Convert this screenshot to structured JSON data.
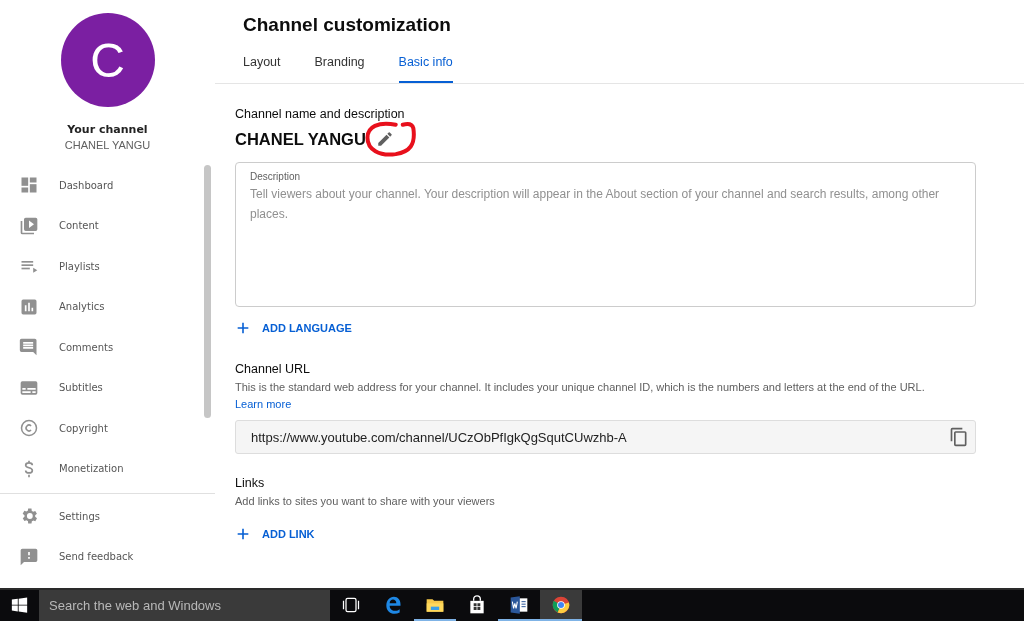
{
  "sidebar": {
    "avatar_letter": "C",
    "channel_label": "Your channel",
    "channel_name": "CHANEL YANGU",
    "items": [
      {
        "label": "Dashboard",
        "selected": false
      },
      {
        "label": "Content",
        "selected": false
      },
      {
        "label": "Playlists",
        "selected": false
      },
      {
        "label": "Analytics",
        "selected": false
      },
      {
        "label": "Comments",
        "selected": false
      },
      {
        "label": "Subtitles",
        "selected": false
      },
      {
        "label": "Copyright",
        "selected": false
      },
      {
        "label": "Monetization",
        "selected": false
      }
    ],
    "footer_items": [
      {
        "label": "Settings"
      },
      {
        "label": "Send feedback"
      }
    ]
  },
  "header": {
    "title": "Channel customization",
    "tabs": [
      {
        "label": "Layout",
        "selected": false
      },
      {
        "label": "Branding",
        "selected": false
      },
      {
        "label": "Basic info",
        "selected": true
      }
    ]
  },
  "name_section": {
    "heading": "Channel name and description",
    "channel_name": "CHANEL YANGU",
    "description": {
      "label": "Description",
      "placeholder": "Tell viewers about your channel. Your description will appear in the About section of your channel and search results, among other places."
    },
    "add_language": "ADD LANGUAGE"
  },
  "url_section": {
    "heading": "Channel URL",
    "text": "This is the standard web address for your channel. It includes your unique channel ID, which is the numbers and letters at the end of the URL.",
    "link": "Learn more",
    "url": "https://www.youtube.com/channel/UCzObPfIgkQgSqutCUwzhb-A"
  },
  "links_section": {
    "heading": "Links",
    "text": "Add links to sites you want to share with your viewers",
    "add_link": "ADD LINK"
  },
  "taskbar": {
    "search_placeholder": "Search the web and Windows",
    "apps": [
      {
        "running": false,
        "selected": false
      },
      {
        "running": false,
        "selected": false
      },
      {
        "running": true,
        "selected": false
      },
      {
        "running": false,
        "selected": false
      },
      {
        "running": true,
        "selected": false
      },
      {
        "running": true,
        "selected": true
      }
    ]
  }
}
